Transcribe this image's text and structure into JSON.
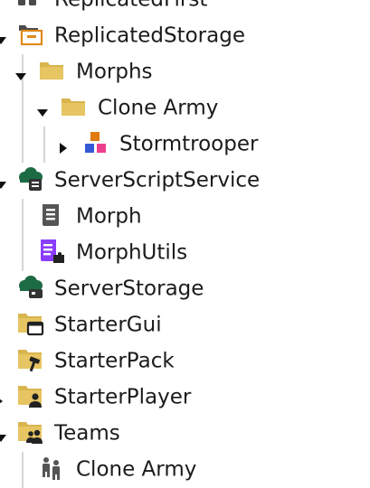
{
  "explorer": {
    "items": [
      {
        "label": "ReplicatedFirst",
        "icon": "replicated-first-icon"
      },
      {
        "label": "ReplicatedStorage",
        "icon": "replicated-storage-icon",
        "expanded": true
      },
      {
        "label": "Morphs",
        "icon": "folder-icon",
        "expanded": true
      },
      {
        "label": "Clone Army",
        "icon": "folder-icon",
        "expanded": true
      },
      {
        "label": "Stormtrooper",
        "icon": "model-icon",
        "expanded": false
      },
      {
        "label": "ServerScriptService",
        "icon": "server-script-service-icon",
        "expanded": true
      },
      {
        "label": "Morph",
        "icon": "script-icon"
      },
      {
        "label": "MorphUtils",
        "icon": "module-script-icon"
      },
      {
        "label": "ServerStorage",
        "icon": "server-storage-icon"
      },
      {
        "label": "StarterGui",
        "icon": "starter-gui-icon"
      },
      {
        "label": "StarterPack",
        "icon": "starter-pack-icon"
      },
      {
        "label": "StarterPlayer",
        "icon": "starter-player-icon",
        "expanded": false
      },
      {
        "label": "Teams",
        "icon": "teams-icon",
        "expanded": true
      },
      {
        "label": "Clone Army",
        "icon": "team-icon"
      }
    ]
  },
  "colors": {
    "folder": "#e2c05a",
    "storage_orange": "#e08a1c",
    "cloud_green": "#1c6b45",
    "module_purple": "#8b3dff",
    "model_blue": "#3559d6",
    "model_pink": "#ee3f8e",
    "model_orange": "#e07b12"
  }
}
